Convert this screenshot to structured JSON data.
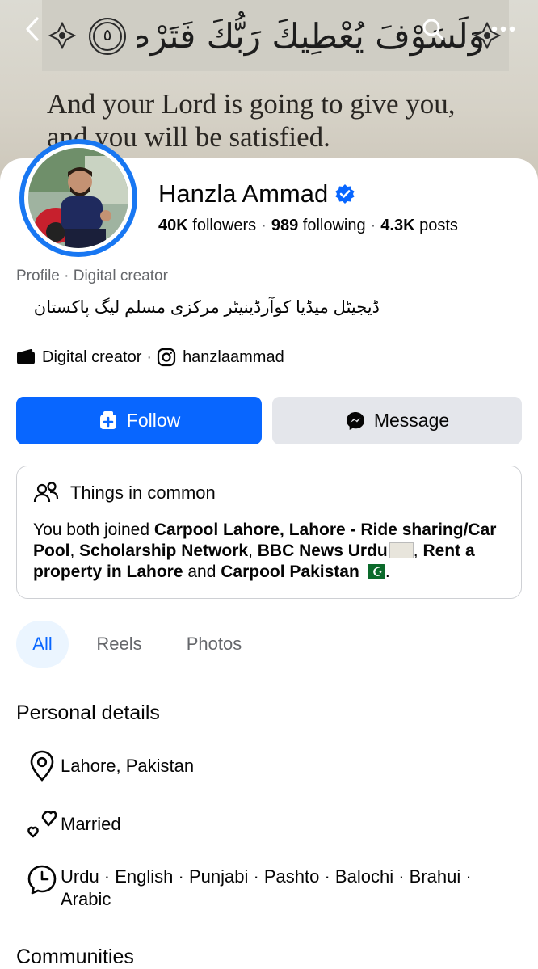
{
  "cover": {
    "arabic_verse": "وَلَسَوْفَ يُعْطِيكَ رَبُّكَ فَتَرْضَىٰ",
    "verse_number": "٥",
    "english_line1": "And your Lord is going to give you,",
    "english_line2": "and you will be satisfied."
  },
  "top_bar": {
    "back_icon": "chevron-left-icon",
    "search_icon": "search-icon",
    "more_icon": "more-dots-icon"
  },
  "profile": {
    "name": "Hanzla Ammad",
    "verified_icon": "verified-badge-icon",
    "followers_count": "40K",
    "followers_label": "followers",
    "following_count": "989",
    "following_label": "following",
    "posts_count": "4.3K",
    "posts_label": "posts",
    "category_line": "Profile · Digital creator",
    "bio_urdu": "ڈیجیٹل میڈیا کوآرڈینیٹر مرکزی مسلم لیگ پاکستان",
    "meta_category": "Digital creator",
    "meta_separator": "·",
    "instagram_handle": "hanzlaammad"
  },
  "actions": {
    "follow_label": "Follow",
    "message_label": "Message"
  },
  "common": {
    "title": "Things in common",
    "prefix": "You both joined ",
    "group1": "Carpool Lahore, Lahore - Ride sharing/Car Pool",
    "sep1": ", ",
    "group2": "Scholarship Network",
    "sep2": ", ",
    "group3": "BBC News Urdu",
    "sep3": ", ",
    "group4": "Rent a property in Lahore",
    "and": " and ",
    "group5": "Carpool Pakistan",
    "end": "."
  },
  "tabs": [
    "All",
    "Reels",
    "Photos"
  ],
  "personal_details": {
    "title": "Personal details",
    "location": "Lahore, Pakistan",
    "relationship": "Married",
    "languages": "Urdu · English · Punjabi · Pashto · Balochi · Brahui · Arabic"
  },
  "communities": {
    "title": "Communities"
  },
  "colors": {
    "accent": "#0866ff",
    "ring": "#1877f2",
    "secondary_button": "#e4e6eb",
    "muted_text": "#65676b"
  }
}
